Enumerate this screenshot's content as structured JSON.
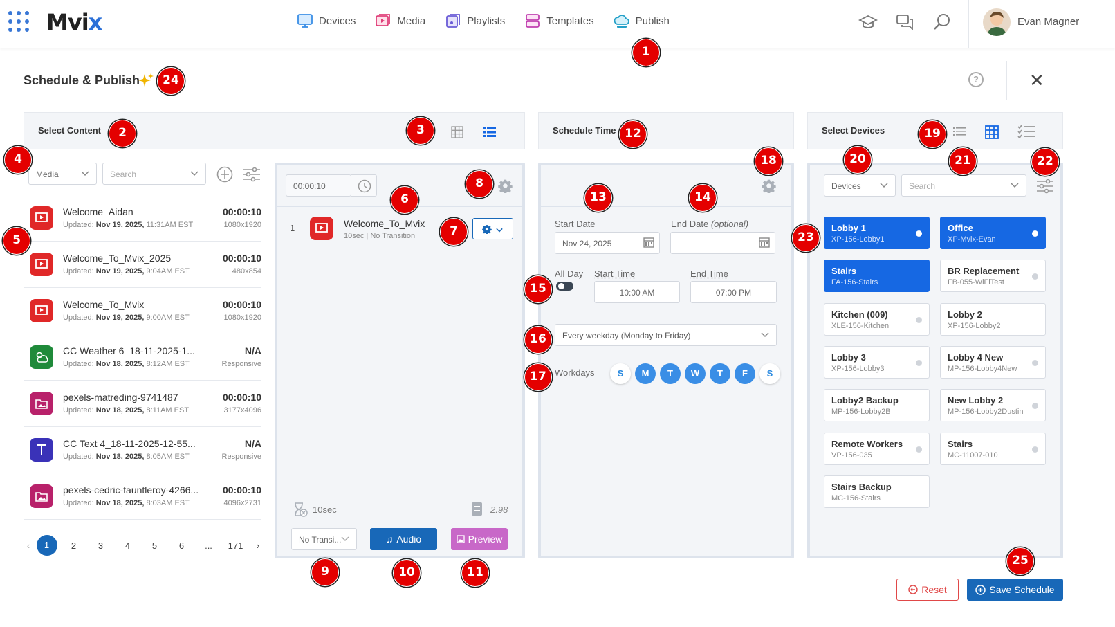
{
  "header": {
    "logo": "Mvi",
    "logo_accent": "x",
    "nav": [
      {
        "label": "Devices",
        "icon": "monitor-icon",
        "color": "#3a8ee6"
      },
      {
        "label": "Media",
        "icon": "media-icon",
        "color": "#e0407a"
      },
      {
        "label": "Playlists",
        "icon": "playlist-icon",
        "color": "#6a5bd6"
      },
      {
        "label": "Templates",
        "icon": "templates-icon",
        "color": "#c040b0"
      },
      {
        "label": "Publish",
        "icon": "cloud-icon",
        "color": "#25a0c8"
      }
    ],
    "user_name": "Evan Magner"
  },
  "page": {
    "title": "Schedule & Publish"
  },
  "content_section": {
    "title": "Select Content",
    "filter_type": "Media",
    "search_placeholder": "Search",
    "items": [
      {
        "name": "Welcome_Aidan",
        "updated_label": "Updated:",
        "date": "Nov 19, 2025,",
        "time": "11:31AM EST",
        "duration": "00:00:10",
        "resolution": "1080x1920",
        "icon": "slideshow-icon",
        "color": "#e02828"
      },
      {
        "name": "Welcome_To_Mvix_2025",
        "updated_label": "Updated:",
        "date": "Nov 19, 2025,",
        "time": "9:04AM EST",
        "duration": "00:00:10",
        "resolution": "480x854",
        "icon": "slideshow-icon",
        "color": "#e02828"
      },
      {
        "name": "Welcome_To_Mvix",
        "updated_label": "Updated:",
        "date": "Nov 19, 2025,",
        "time": "9:00AM EST",
        "duration": "00:00:10",
        "resolution": "1080x1920",
        "icon": "slideshow-icon",
        "color": "#e02828"
      },
      {
        "name": "CC Weather 6_18-11-2025-1...",
        "updated_label": "Updated:",
        "date": "Nov 18, 2025,",
        "time": "8:12AM EST",
        "duration": "N/A",
        "resolution": "Responsive",
        "icon": "weather-icon",
        "color": "#1f8a3a"
      },
      {
        "name": "pexels-matreding-9741487",
        "updated_label": "Updated:",
        "date": "Nov 18, 2025,",
        "time": "8:11AM EST",
        "duration": "00:00:10",
        "resolution": "3177x4096",
        "icon": "image-icon",
        "color": "#b8216a"
      },
      {
        "name": "CC Text 4_18-11-2025-12-55...",
        "updated_label": "Updated:",
        "date": "Nov 18, 2025,",
        "time": "8:05AM EST",
        "duration": "N/A",
        "resolution": "Responsive",
        "icon": "text-icon",
        "color": "#3a32b8"
      },
      {
        "name": "pexels-cedric-fauntleroy-4266...",
        "updated_label": "Updated:",
        "date": "Nov 18, 2025,",
        "time": "8:03AM EST",
        "duration": "00:00:10",
        "resolution": "4096x2731",
        "icon": "image-icon",
        "color": "#b8216a"
      }
    ],
    "pagination": [
      "1",
      "2",
      "3",
      "4",
      "5",
      "6",
      "...",
      "171"
    ]
  },
  "playlist_panel": {
    "duration_value": "00:00:10",
    "item_index": "1",
    "item_name": "Welcome_To_Mvix",
    "item_meta": "10sec | No Transition",
    "total_duration": "10sec",
    "total_size": "2.98",
    "transition_value": "No Transi...",
    "audio_label": "Audio",
    "preview_label": "Preview"
  },
  "schedule_section": {
    "title": "Schedule Time",
    "start_date_label": "Start Date",
    "start_date_value": "Nov 24, 2025",
    "end_date_label": "End Date",
    "end_date_optional": "(optional)",
    "all_day_label": "All Day",
    "start_time_label": "Start Time",
    "start_time_value": "10:00 AM",
    "end_time_label": "End Time",
    "end_time_value": "07:00 PM",
    "recurrence": "Every weekday (Monday to Friday)",
    "workdays_label": "Workdays",
    "days": [
      {
        "label": "S",
        "active": false
      },
      {
        "label": "M",
        "active": true
      },
      {
        "label": "T",
        "active": true
      },
      {
        "label": "W",
        "active": true
      },
      {
        "label": "T",
        "active": true
      },
      {
        "label": "F",
        "active": true
      },
      {
        "label": "S",
        "active": false
      }
    ]
  },
  "devices_section": {
    "title": "Select Devices",
    "filter_type": "Devices",
    "search_placeholder": "Search",
    "devices": [
      {
        "name": "Lobby 1",
        "id": "XP-156-Lobby1",
        "selected": true
      },
      {
        "name": "Office",
        "id": "XP-Mvix-Evan",
        "selected": true
      },
      {
        "name": "Stairs",
        "id": "FA-156-Stairs",
        "selected": true
      },
      {
        "name": "BR Replacement",
        "id": "FB-055-WiFiTest",
        "selected": false
      },
      {
        "name": "Kitchen (009)",
        "id": "XLE-156-Kitchen",
        "selected": false
      },
      {
        "name": "Lobby 2",
        "id": "XP-156-Lobby2",
        "selected": false
      },
      {
        "name": "Lobby 3",
        "id": "XP-156-Lobby3",
        "selected": false
      },
      {
        "name": "Lobby 4 New",
        "id": "MP-156-Lobby4New",
        "selected": false
      },
      {
        "name": "Lobby2 Backup",
        "id": "MP-156-Lobby2B",
        "selected": false
      },
      {
        "name": "New Lobby 2",
        "id": "MP-156-Lobby2Dustin",
        "selected": false
      },
      {
        "name": "Remote Workers",
        "id": "VP-156-035",
        "selected": false
      },
      {
        "name": "Stairs",
        "id": "MC-11007-010",
        "selected": false
      },
      {
        "name": "Stairs Backup",
        "id": "MC-156-Stairs",
        "selected": false
      }
    ]
  },
  "footer": {
    "reset_label": "Reset",
    "save_label": "Save Schedule"
  },
  "annotations": [
    "1",
    "2",
    "3",
    "4",
    "5",
    "6",
    "7",
    "8",
    "9",
    "10",
    "11",
    "12",
    "13",
    "14",
    "15",
    "16",
    "17",
    "18",
    "19",
    "20",
    "21",
    "22",
    "23",
    "24",
    "25"
  ],
  "colors": {
    "accent": "#1668e3",
    "primary_button": "#1868b8",
    "badge": "#e40000",
    "preview": "#c868c8",
    "reset": "#e04848"
  }
}
